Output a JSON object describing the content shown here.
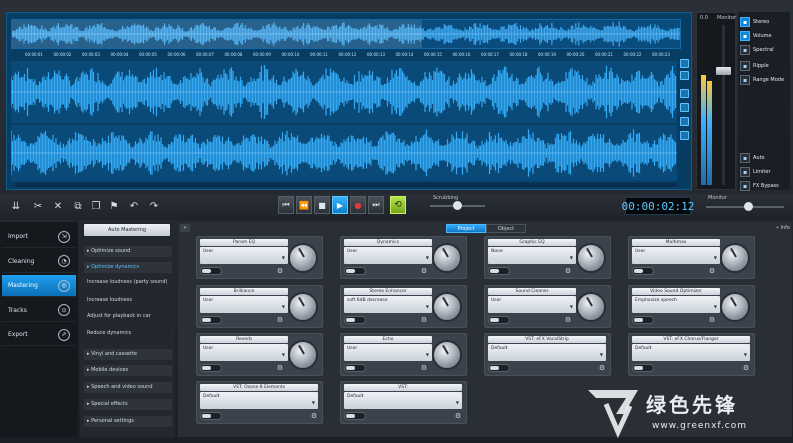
{
  "waveform": {
    "ruler_ticks": [
      "00:00:01",
      "00:00:02",
      "00:00:03",
      "00:00:04",
      "00:00:05",
      "00:00:06",
      "00:00:07",
      "00:00:08",
      "00:00:09",
      "00:00:10",
      "00:00:11",
      "00:00:12",
      "00:00:13",
      "00:00:14",
      "00:00:15",
      "00:00:16",
      "00:00:17",
      "00:00:18",
      "00:00:19",
      "00:00:20",
      "00:00:21",
      "00:00:22",
      "00:00:23"
    ]
  },
  "meters": {
    "label_left": "0.0",
    "label_right": "Monitor"
  },
  "view_options": [
    {
      "label": "Stereo",
      "icon": "stereo-icon",
      "active": true
    },
    {
      "label": "Volume",
      "icon": "volume-icon",
      "active": true
    },
    {
      "label": "Spectral",
      "icon": "spectral-icon",
      "active": false
    },
    {
      "label": "Ripple",
      "icon": "ripple-icon",
      "active": false
    },
    {
      "label": "Range Mode",
      "icon": "range-icon",
      "active": false
    },
    {
      "label": "Auto",
      "icon": "auto-icon",
      "active": false
    },
    {
      "label": "Limiter",
      "icon": "limiter-icon",
      "active": false
    },
    {
      "label": "FX Bypass",
      "icon": "fx-bypass-icon",
      "active": false
    }
  ],
  "toolbar": {
    "tools": [
      {
        "icon": "expand-icon",
        "glyph": "⇊"
      },
      {
        "icon": "cut-icon",
        "glyph": "✂"
      },
      {
        "icon": "close-icon",
        "glyph": "✕"
      },
      {
        "icon": "copy-icon",
        "glyph": "⧉"
      },
      {
        "icon": "paste-icon",
        "glyph": "❐"
      },
      {
        "icon": "flag-icon",
        "glyph": "⚑"
      },
      {
        "icon": "undo-icon",
        "glyph": "↶"
      },
      {
        "icon": "redo-icon",
        "glyph": "↷"
      }
    ],
    "transport": [
      {
        "icon": "skip-back-icon",
        "glyph": "⏮"
      },
      {
        "icon": "rewind-icon",
        "glyph": "⏪"
      },
      {
        "icon": "stop-icon",
        "glyph": "■"
      },
      {
        "icon": "play-icon",
        "glyph": "▶"
      },
      {
        "icon": "record-icon",
        "glyph": "●"
      },
      {
        "icon": "skip-forward-icon",
        "glyph": "⏭"
      }
    ],
    "loop_glyph": "⟲",
    "scrubbing_label": "Scrubbing",
    "timecode": "00:00:02:12",
    "monitor_label": "Monitor"
  },
  "nav": [
    {
      "label": "Import",
      "icon": "import-icon",
      "glyph": "⇲",
      "active": false
    },
    {
      "label": "Cleaning",
      "icon": "cleaning-icon",
      "glyph": "◔",
      "active": false
    },
    {
      "label": "Mastering",
      "icon": "mastering-icon",
      "glyph": "◎",
      "active": true
    },
    {
      "label": "Tracks",
      "icon": "tracks-icon",
      "glyph": "⊙",
      "active": false
    },
    {
      "label": "Export",
      "icon": "export-icon",
      "glyph": "⇗",
      "active": false
    }
  ],
  "submenu": {
    "top_button": "Auto Mastering",
    "items": [
      {
        "label": "▸ Optimize sound",
        "group": true,
        "selected": false
      },
      {
        "label": "▸ Optimize dynamics",
        "group": true,
        "selected": true
      },
      {
        "label": "Increase loudness (party sound)",
        "group": false,
        "selected": false
      },
      {
        "label": "Increase loudness",
        "group": false,
        "selected": false
      },
      {
        "label": "Adjust for playback in car",
        "group": false,
        "selected": false
      },
      {
        "label": "Reduce dynamics",
        "group": false,
        "selected": false
      },
      {
        "label": "▸ Vinyl and cassette",
        "group": true,
        "selected": false
      },
      {
        "label": "▸ Mobile devices",
        "group": true,
        "selected": false
      },
      {
        "label": "▸ Speech and video sound",
        "group": true,
        "selected": false
      },
      {
        "label": "▸ Special effects",
        "group": true,
        "selected": false
      },
      {
        "label": "▸ Personal settings",
        "group": true,
        "selected": false
      }
    ]
  },
  "fx": {
    "collapse_glyph": "«",
    "tabs": [
      {
        "label": "Project",
        "active": true
      },
      {
        "label": "Object",
        "active": false
      }
    ],
    "info_label": "« Info",
    "cards": [
      {
        "title": "Param EQ",
        "value": "User",
        "knob": true,
        "wide": false
      },
      {
        "title": "Dynamics",
        "value": "User",
        "knob": true,
        "wide": false
      },
      {
        "title": "Graphic EQ",
        "value": "None",
        "knob": true,
        "wide": false
      },
      {
        "title": "Multimax",
        "value": "User",
        "knob": true,
        "wide": false
      },
      {
        "title": "Brilliance",
        "value": "User",
        "knob": true,
        "wide": false
      },
      {
        "title": "Stereo Enhancer",
        "value": "soft 6dB decrease",
        "knob": true,
        "wide": false
      },
      {
        "title": "Sound Cleaner",
        "value": "User",
        "knob": true,
        "wide": false
      },
      {
        "title": "Video Sound Optimizer",
        "value": "Emphasize speech",
        "knob": true,
        "wide": false
      },
      {
        "title": "Reverb",
        "value": "User",
        "knob": true,
        "wide": false
      },
      {
        "title": "Echo",
        "value": "User",
        "knob": true,
        "wide": false
      },
      {
        "title": "VST: eFX VocalStrip",
        "value": "Default",
        "knob": false,
        "wide": true
      },
      {
        "title": "VST: eFX Chorus/Flanger",
        "value": "Default",
        "knob": false,
        "wide": true
      },
      {
        "title": "VST: Ozone 8 Elements",
        "value": "Default",
        "knob": false,
        "wide": true
      },
      {
        "title": "VST:",
        "value": "Default",
        "knob": false,
        "wide": true
      }
    ],
    "gear_glyph": "⚙",
    "caret_glyph": "▼"
  },
  "watermark": {
    "text": "绿色先锋",
    "url": "www.greenxf.com"
  }
}
